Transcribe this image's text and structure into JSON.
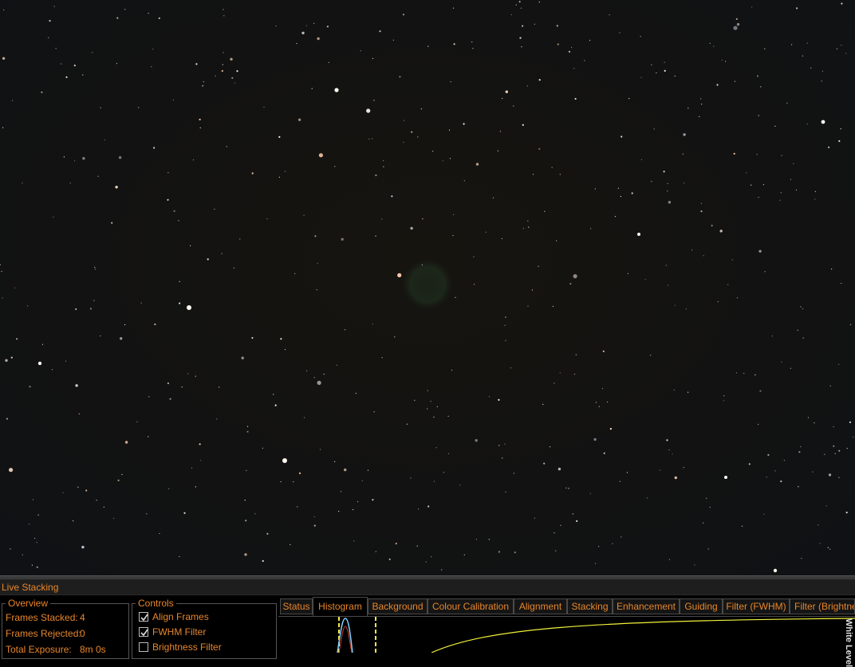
{
  "viewer": {
    "image_description_name": "star-field-image"
  },
  "panel": {
    "title": "Live Stacking"
  },
  "overview": {
    "label": "Overview",
    "rows": [
      {
        "label": "Frames Stacked:",
        "value": "4"
      },
      {
        "label": "Frames Rejected:",
        "value": "0"
      },
      {
        "label": "Total Exposure:",
        "value": "8m 0s"
      }
    ]
  },
  "controls": {
    "label": "Controls",
    "items": [
      {
        "label": "Align Frames",
        "checked": true
      },
      {
        "label": "FWHM Filter",
        "checked": true
      },
      {
        "label": "Brightness Filter",
        "checked": false
      }
    ]
  },
  "tabs": [
    {
      "label": "Status",
      "active": false
    },
    {
      "label": "Histogram",
      "active": true
    },
    {
      "label": "Background",
      "active": false
    },
    {
      "label": "Colour Calibration",
      "active": false
    },
    {
      "label": "Alignment",
      "active": false
    },
    {
      "label": "Stacking",
      "active": false
    },
    {
      "label": "Enhancement",
      "active": false
    },
    {
      "label": "Guiding",
      "active": false
    },
    {
      "label": "Filter (FWHM)",
      "active": false
    },
    {
      "label": "Filter (Brightness)",
      "active": false
    }
  ],
  "histogram": {
    "side_label": "White Level"
  },
  "colors": {
    "accent": "#e8862a",
    "sky": "#13110f",
    "curve": "#f2f23a",
    "histo_blue": "#7fd4ff",
    "marker": "#f5e94a"
  }
}
